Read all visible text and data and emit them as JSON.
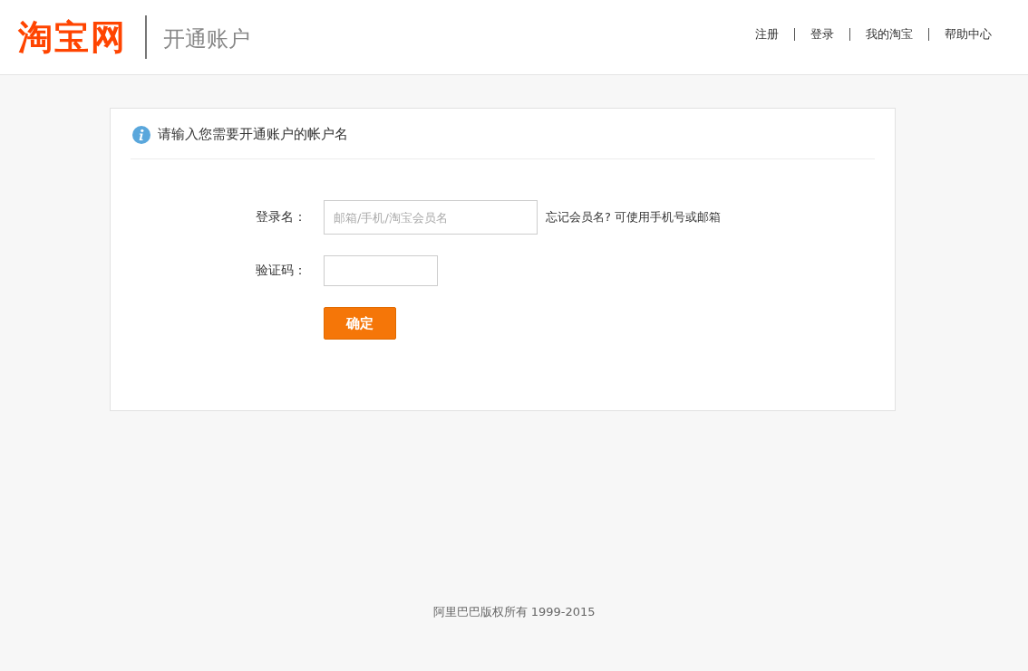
{
  "header": {
    "logo": "淘宝网",
    "page_title": "开通账户",
    "nav": [
      {
        "label": "注册"
      },
      {
        "label": "登录"
      },
      {
        "label": "我的淘宝"
      },
      {
        "label": "帮助中心"
      }
    ]
  },
  "card": {
    "notice": "请输入您需要开通账户的帐户名",
    "fields": [
      {
        "label": "登录名：",
        "placeholder": "邮箱/手机/淘宝会员名",
        "kind": "wide",
        "hint_link": "忘记会员名? 可使用手机号或邮箱"
      },
      {
        "label": "验证码：",
        "kind": "short"
      }
    ],
    "submit": "确定"
  },
  "footer": {
    "copyright": "阿里巴巴版权所有 1999-2015"
  }
}
